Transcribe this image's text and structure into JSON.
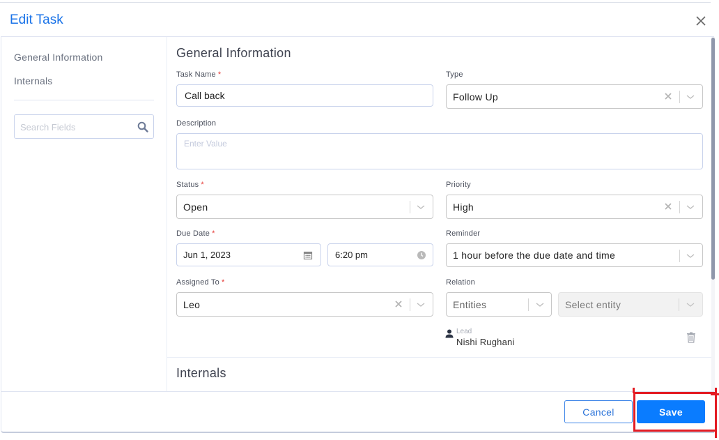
{
  "modal": {
    "title": "Edit Task",
    "close_icon": "close-icon"
  },
  "sidebar": {
    "items": [
      {
        "label": "General Information"
      },
      {
        "label": "Internals"
      }
    ],
    "search": {
      "placeholder": "Search Fields",
      "value": "",
      "icon": "search-icon"
    }
  },
  "form": {
    "section_general": "General Information",
    "section_internals": "Internals",
    "task_name": {
      "label": "Task Name",
      "required": "*",
      "value": "Call back"
    },
    "type": {
      "label": "Type",
      "value": "Follow Up"
    },
    "description": {
      "label": "Description",
      "placeholder": "Enter Value",
      "value": ""
    },
    "status": {
      "label": "Status",
      "required": "*",
      "value": "Open"
    },
    "priority": {
      "label": "Priority",
      "value": "High"
    },
    "due_date": {
      "label": "Due Date",
      "required": "*",
      "date": "Jun 1, 2023",
      "time": "6:20 pm"
    },
    "reminder": {
      "label": "Reminder",
      "value": "1 hour before the due date and time"
    },
    "assigned_to": {
      "label": "Assigned To",
      "required": "*",
      "value": "Leo"
    },
    "relation": {
      "label": "Relation",
      "entities_value": "Entities",
      "entity_placeholder": "Select entity",
      "linked": {
        "type": "Lead",
        "name": "Nishi Rughani"
      }
    }
  },
  "footer": {
    "cancel_label": "Cancel",
    "save_label": "Save"
  },
  "colors": {
    "accent": "#0a7cff",
    "title": "#1a73e8",
    "highlight": "#e31c23",
    "required": "#e53935"
  }
}
